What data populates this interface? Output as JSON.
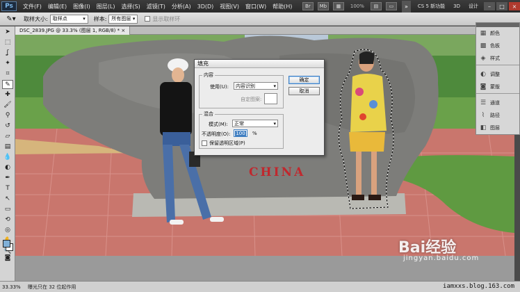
{
  "menubar": {
    "logo": "Ps",
    "items": [
      "文件(F)",
      "编辑(E)",
      "图像(I)",
      "图层(L)",
      "选择(S)",
      "滤镜(T)",
      "分析(A)",
      "3D(D)",
      "视图(V)",
      "窗口(W)",
      "帮助(H)"
    ],
    "zoom": "100%",
    "workspace": [
      "CS 5 新功能",
      "3D",
      "设计"
    ],
    "collapse": "»"
  },
  "options": {
    "sample_size_label": "取样大小:",
    "sample_size_value": "取样点",
    "sample_label": "样本:",
    "sample_value": "所有图层",
    "show_ring_label": "显示取样环"
  },
  "document": {
    "tab_title": "DSC_2839.JPG @ 33.3% (图层 1, RGB/8) *"
  },
  "dialog": {
    "title": "填充",
    "content_group": "内容",
    "use_label": "使用(U):",
    "use_value": "内容识别",
    "custom_pattern_label": "自定图案:",
    "blend_group": "混合",
    "mode_label": "模式(M):",
    "mode_value": "正常",
    "opacity_label": "不透明度(O):",
    "opacity_value": "100",
    "opacity_unit": "%",
    "preserve_label": "保留透明区域(P)",
    "ok": "确定",
    "cancel": "取消"
  },
  "panels": {
    "items": [
      {
        "label": "颜色",
        "icon": "palette-icon"
      },
      {
        "label": "色板",
        "icon": "swatches-icon"
      },
      {
        "label": "样式",
        "icon": "styles-icon"
      },
      {
        "label": "调整",
        "icon": "adjust-icon"
      },
      {
        "label": "蒙版",
        "icon": "mask-icon"
      },
      {
        "label": "通道",
        "icon": "channels-icon"
      },
      {
        "label": "路径",
        "icon": "paths-icon"
      },
      {
        "label": "图层",
        "icon": "layers-icon"
      }
    ]
  },
  "photo": {
    "stone_text": "CHINA"
  },
  "status": {
    "zoom": "33.33%",
    "info": "曝光只在 32 位起作用",
    "blog": "iamxxs.blog.163.com"
  },
  "watermark": {
    "brand": "Bai经验",
    "url": "jingyan.baidu.com"
  }
}
